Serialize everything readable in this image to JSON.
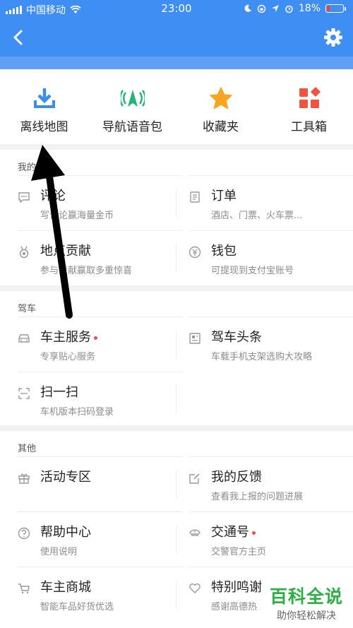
{
  "status_bar": {
    "carrier": "中国移动",
    "time": "23:00",
    "battery": "18%",
    "battery_level": 0.18
  },
  "header": {
    "back_icon": "back-chevron",
    "settings_icon": "gear-icon"
  },
  "quick_actions": [
    {
      "label": "离线地图",
      "icon": "download-icon",
      "color": "#3a8ee6"
    },
    {
      "label": "导航语音包",
      "icon": "navigation-voice-icon",
      "color": "#22b573"
    },
    {
      "label": "收藏夹",
      "icon": "star-icon",
      "color": "#f6a623"
    },
    {
      "label": "工具箱",
      "icon": "toolbox-icon",
      "color": "#f0533f"
    }
  ],
  "sections": {
    "mine": {
      "title": "我的",
      "items": [
        {
          "name": "评论",
          "sub": "写评论赢海量金币",
          "icon": "comment-icon"
        },
        {
          "name": "订单",
          "sub": "酒店、门票、火车票...",
          "icon": "order-icon"
        },
        {
          "name": "地点贡献",
          "sub": "参与贡献赢取多重惊喜",
          "icon": "medal-icon"
        },
        {
          "name": "钱包",
          "sub": "可提现到支付宝账号",
          "icon": "wallet-icon"
        }
      ]
    },
    "driving": {
      "title": "驾车",
      "items": [
        {
          "name": "车主服务",
          "sub": "专享贴心服务",
          "icon": "car-icon"
        },
        {
          "name": "驾车头条",
          "sub": "车载手机支架选购大攻略",
          "icon": "news-icon"
        },
        {
          "name": "扫一扫",
          "sub": "车机版本扫码登录",
          "icon": "scan-icon"
        }
      ]
    },
    "other": {
      "title": "其他",
      "items": [
        {
          "name": "活动专区",
          "sub": "",
          "icon": "gift-icon"
        },
        {
          "name": "我的反馈",
          "sub": "查看我上报的问题进展",
          "icon": "edit-icon"
        },
        {
          "name": "帮助中心",
          "sub": "使用说明",
          "icon": "help-icon"
        },
        {
          "name": "交通号",
          "sub": "交警官方主页",
          "icon": "police-hat-icon"
        },
        {
          "name": "车主商城",
          "sub": "智能车品好货优选",
          "icon": "cart-icon"
        },
        {
          "name": "特别鸣谢",
          "sub": "感谢高德热",
          "icon": "heart-icon"
        }
      ]
    }
  },
  "watermark": {
    "big": "百科全说",
    "small": "助你轻松解决"
  }
}
